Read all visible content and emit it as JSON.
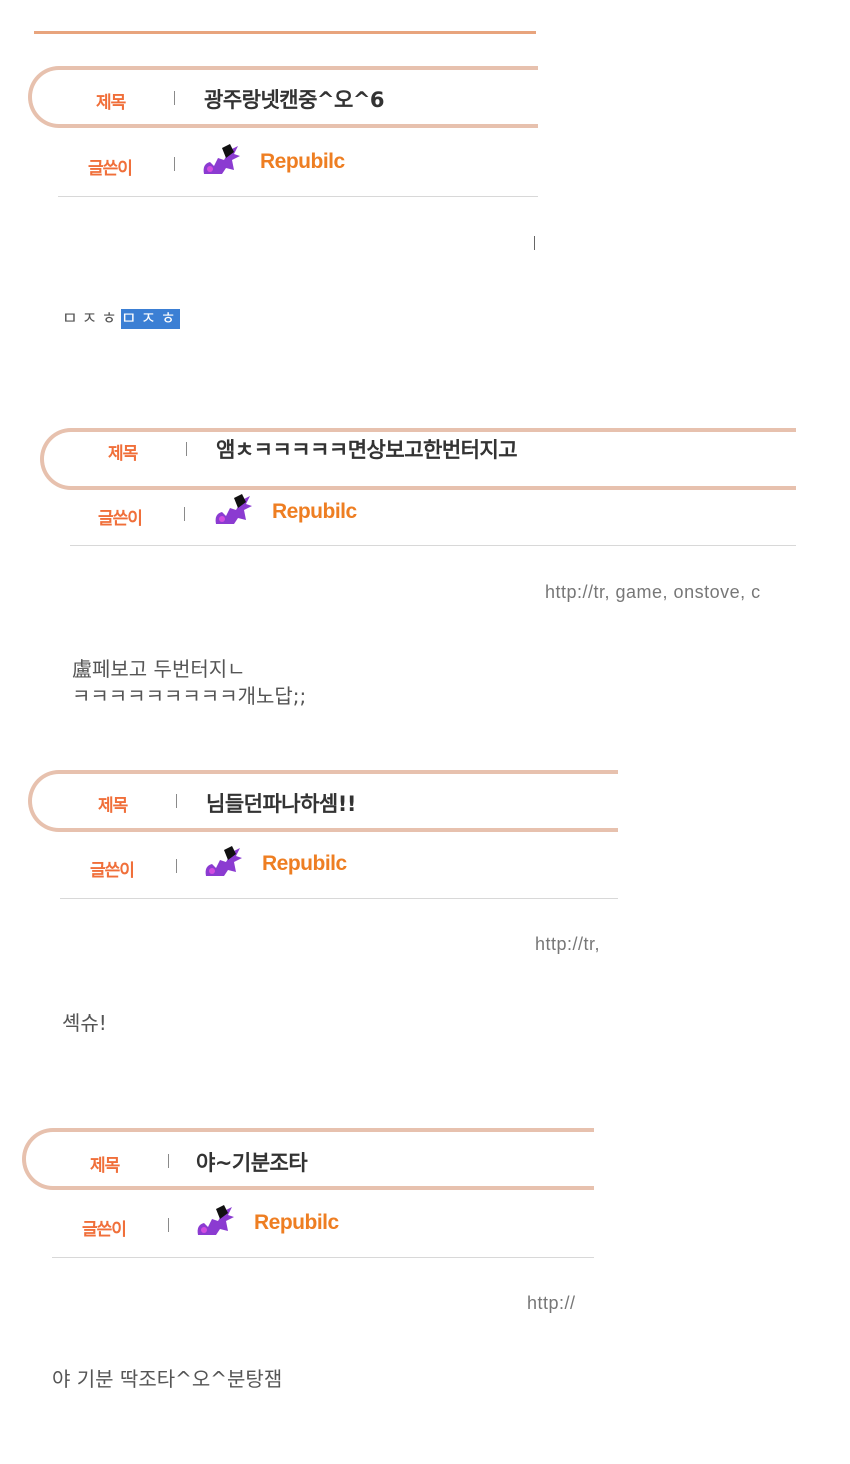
{
  "labels": {
    "subject": "제목",
    "writer": "글쓴이"
  },
  "posts": [
    {
      "title": "광주랑넷캔중^오^6",
      "author": "Repubilc",
      "link": "",
      "body": "ㅁㅈㅎ",
      "body_selected": "ㅁㅈㅎ"
    },
    {
      "title": "앰ㅊㅋㅋㅋㅋㅋ면상보고한번터지고",
      "author": "Repubilc",
      "link": "http://tr, game, onstove, c",
      "body": "盧페보고 두번터지ㄴ\nㅋㅋㅋㅋㅋㅋㅋㅋㅋ개노답;;"
    },
    {
      "title": "님들던파나하셈!!",
      "author": "Repubilc",
      "link": "http://tr,",
      "body": "셱슈!"
    },
    {
      "title": "야~기분조타",
      "author": "Repubilc",
      "link": "http://",
      "body": "야 기분 딱조타^오^분탕잼"
    }
  ],
  "colors": {
    "label": "#f06f3a",
    "author": "#ee7e22",
    "border": "#e7c1ae",
    "selection": "#3b7fd4"
  },
  "icons": {
    "avatar": "purple-dragon-icon"
  }
}
